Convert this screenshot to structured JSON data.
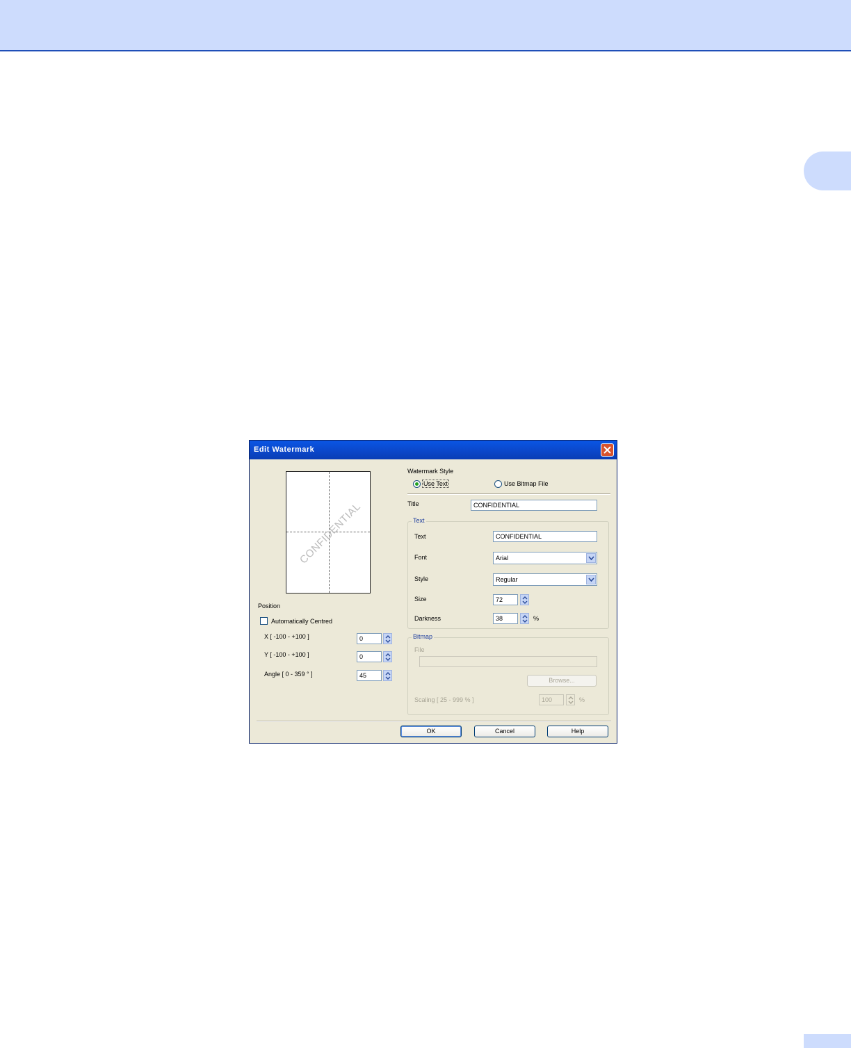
{
  "dialog": {
    "title": "Edit Watermark",
    "preview_text": "CONFIDENTIAL",
    "position": {
      "heading": "Position",
      "auto_centred_label": "Automatically Centred",
      "auto_centred_checked": false,
      "x_label": "X [ -100 - +100 ]",
      "x_value": "0",
      "y_label": "Y [ -100 - +100 ]",
      "y_value": "0",
      "angle_label": "Angle [ 0 - 359 ° ]",
      "angle_value": "45"
    },
    "style": {
      "heading": "Watermark Style",
      "use_text_label": "Use Text",
      "use_bitmap_label": "Use Bitmap File",
      "selected": "Use Text"
    },
    "title_field": {
      "label": "Title",
      "value": "CONFIDENTIAL"
    },
    "text_group": {
      "heading": "Text",
      "text_label": "Text",
      "text_value": "CONFIDENTIAL",
      "font_label": "Font",
      "font_value": "Arial",
      "style_label": "Style",
      "style_value": "Regular",
      "size_label": "Size",
      "size_value": "72",
      "darkness_label": "Darkness",
      "darkness_value": "38",
      "darkness_unit": "%"
    },
    "bitmap_group": {
      "heading": "Bitmap",
      "file_label": "File",
      "file_value": "",
      "browse_label": "Browse...",
      "scaling_label": "Scaling [ 25 - 999 % ]",
      "scaling_value": "100",
      "scaling_unit": "%"
    },
    "buttons": {
      "ok": "OK",
      "cancel": "Cancel",
      "help": "Help"
    }
  },
  "colors": {
    "header_band": "#cddcfd",
    "header_line": "#1f4fb8",
    "dialog_bg": "#ece9d8",
    "titlebar": "#0a46c8"
  }
}
